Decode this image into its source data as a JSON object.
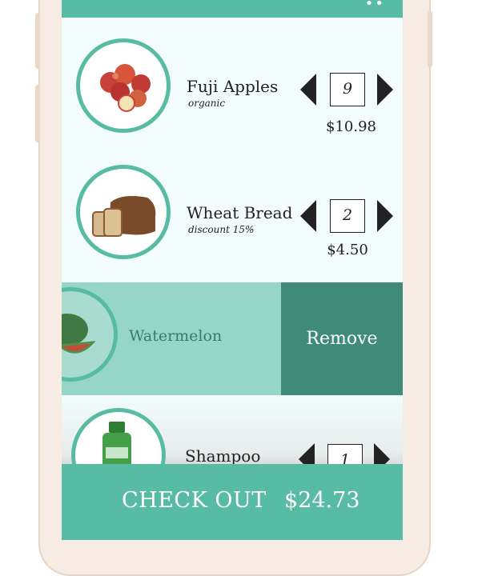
{
  "cart": {
    "items": [
      {
        "name": "Fuji Apples",
        "subtitle": "organic",
        "quantity": "9",
        "price": "$10.98"
      },
      {
        "name": "Wheat Bread",
        "subtitle": "discount 15%",
        "quantity": "2",
        "price": "$4.50"
      },
      {
        "name": "Watermelon"
      },
      {
        "name": "Shampoo",
        "quantity": "1"
      }
    ],
    "remove_label": "Remove"
  },
  "checkout": {
    "label": "CHECK OUT",
    "total": "$24.73"
  },
  "colors": {
    "accent": "#58bba3",
    "accent_light": "#95d6c6",
    "remove": "#3f8a79",
    "background": "#f2fcfc"
  }
}
